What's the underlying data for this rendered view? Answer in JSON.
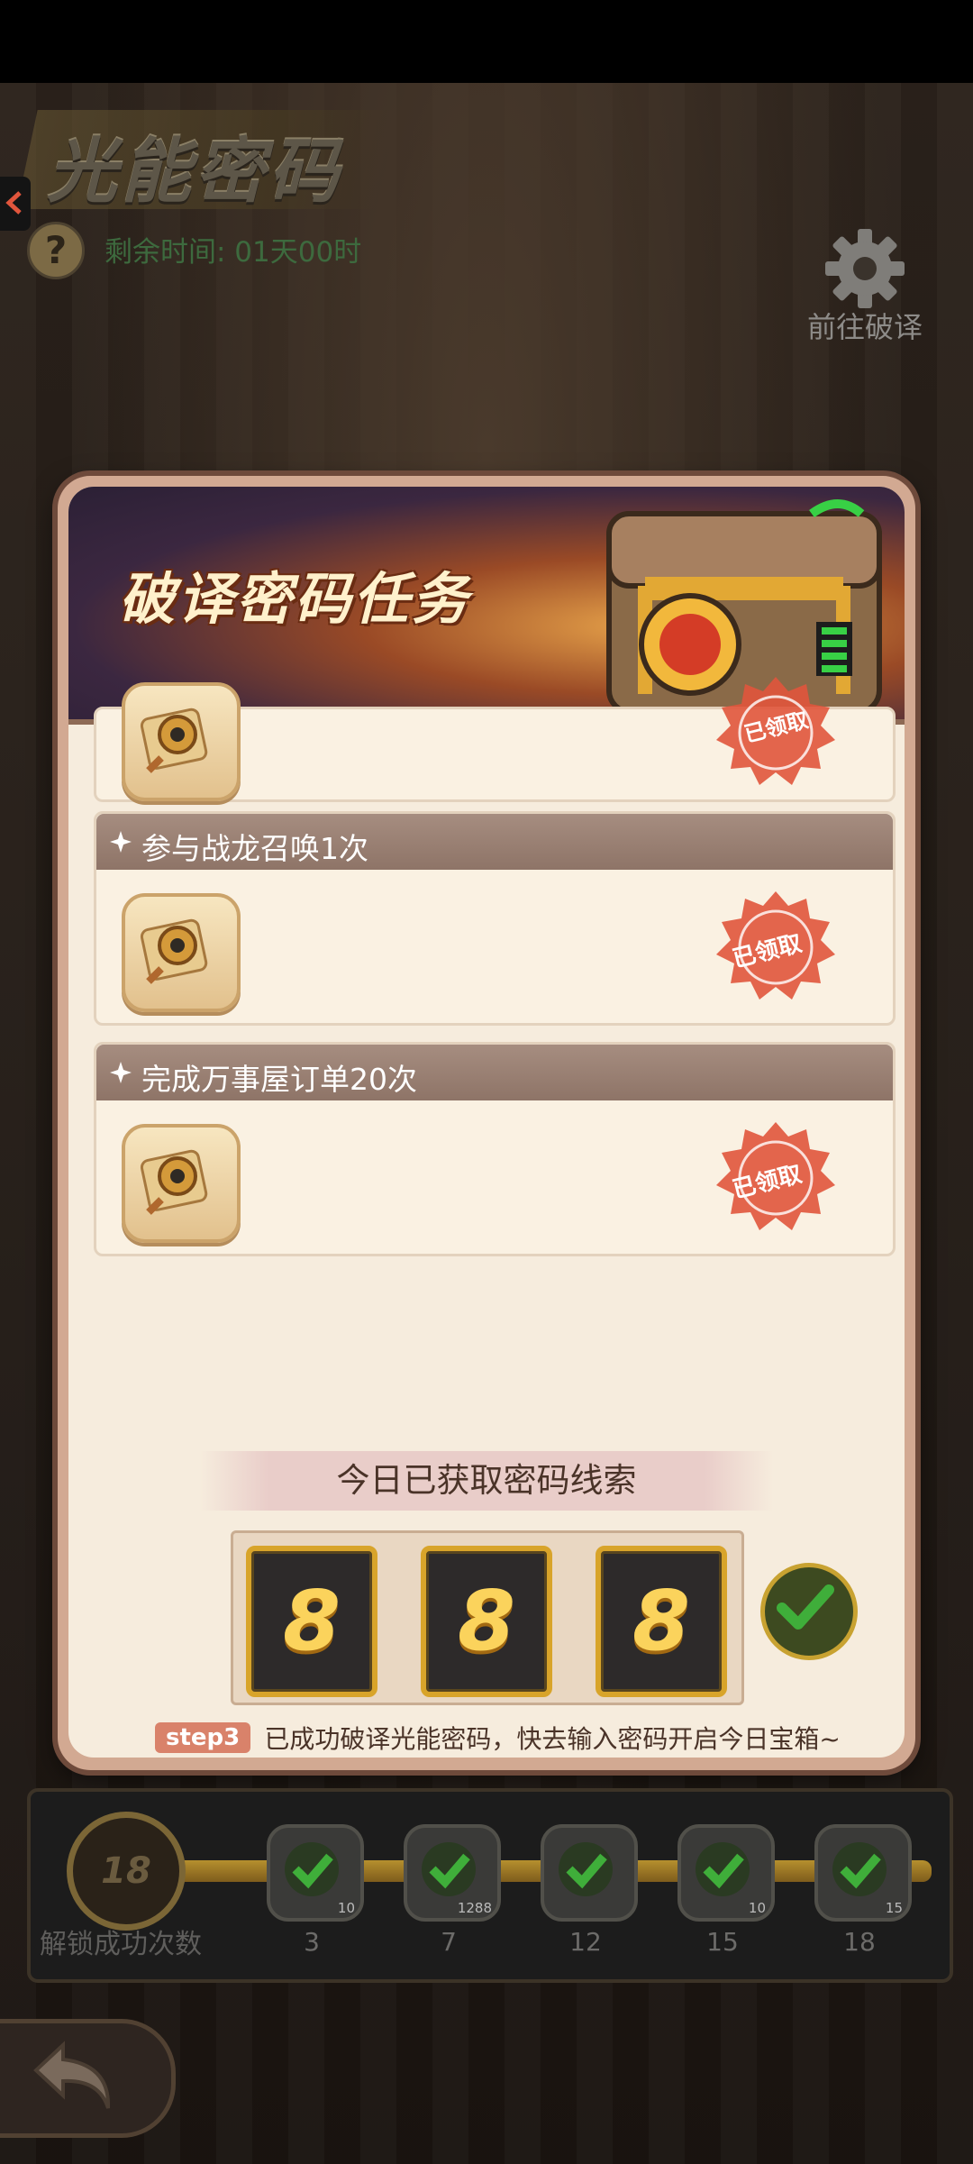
{
  "header": {
    "title": "光能密码",
    "timer": "剩余时间: 01天00时",
    "decode_label": "前往破译"
  },
  "modal": {
    "banner_title": "破译密码任务",
    "tasks": [
      {
        "title": "",
        "status": "已领取"
      },
      {
        "title": "参与战龙召唤1次",
        "status": "已领取"
      },
      {
        "title": "完成万事屋订单20次",
        "status": "已领取"
      }
    ],
    "clue_title": "今日已获取密码线索",
    "digits": [
      "8",
      "8",
      "8"
    ],
    "step_badge": "step3",
    "step_text": "已成功破译光能密码，快去输入密码开启今日宝箱~"
  },
  "progress": {
    "count": "18",
    "count_label": "解锁成功次数",
    "fill_fraction": 1.0,
    "milestones": [
      {
        "num": "3",
        "qty": "10"
      },
      {
        "num": "7",
        "qty": "1288"
      },
      {
        "num": "12",
        "qty": ""
      },
      {
        "num": "15",
        "qty": "10"
      },
      {
        "num": "18",
        "qty": "15"
      }
    ]
  },
  "colors": {
    "accent_gold": "#d8a42a",
    "stamp_red": "#e0553c",
    "check_green": "#3fae3a"
  }
}
